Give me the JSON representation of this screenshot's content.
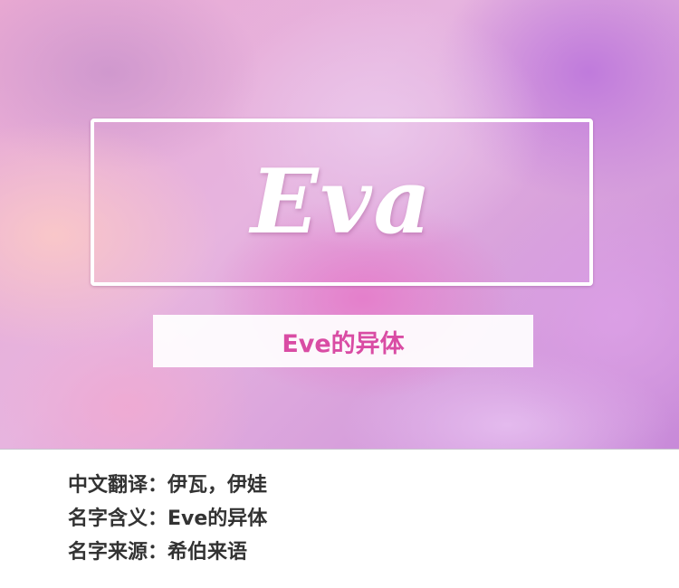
{
  "hero": {
    "name": "Eva",
    "subtitle": "Eve的异体"
  },
  "info": {
    "rows": [
      {
        "label": "中文翻译：",
        "value": "伊瓦，伊娃"
      },
      {
        "label": "名字含义：",
        "value": "Eve的异体"
      },
      {
        "label": "名字来源：",
        "value": "希伯来语"
      }
    ]
  },
  "colors": {
    "subtitle_text": "#d94ca4",
    "info_text": "#333333",
    "frame": "#ffffff"
  }
}
